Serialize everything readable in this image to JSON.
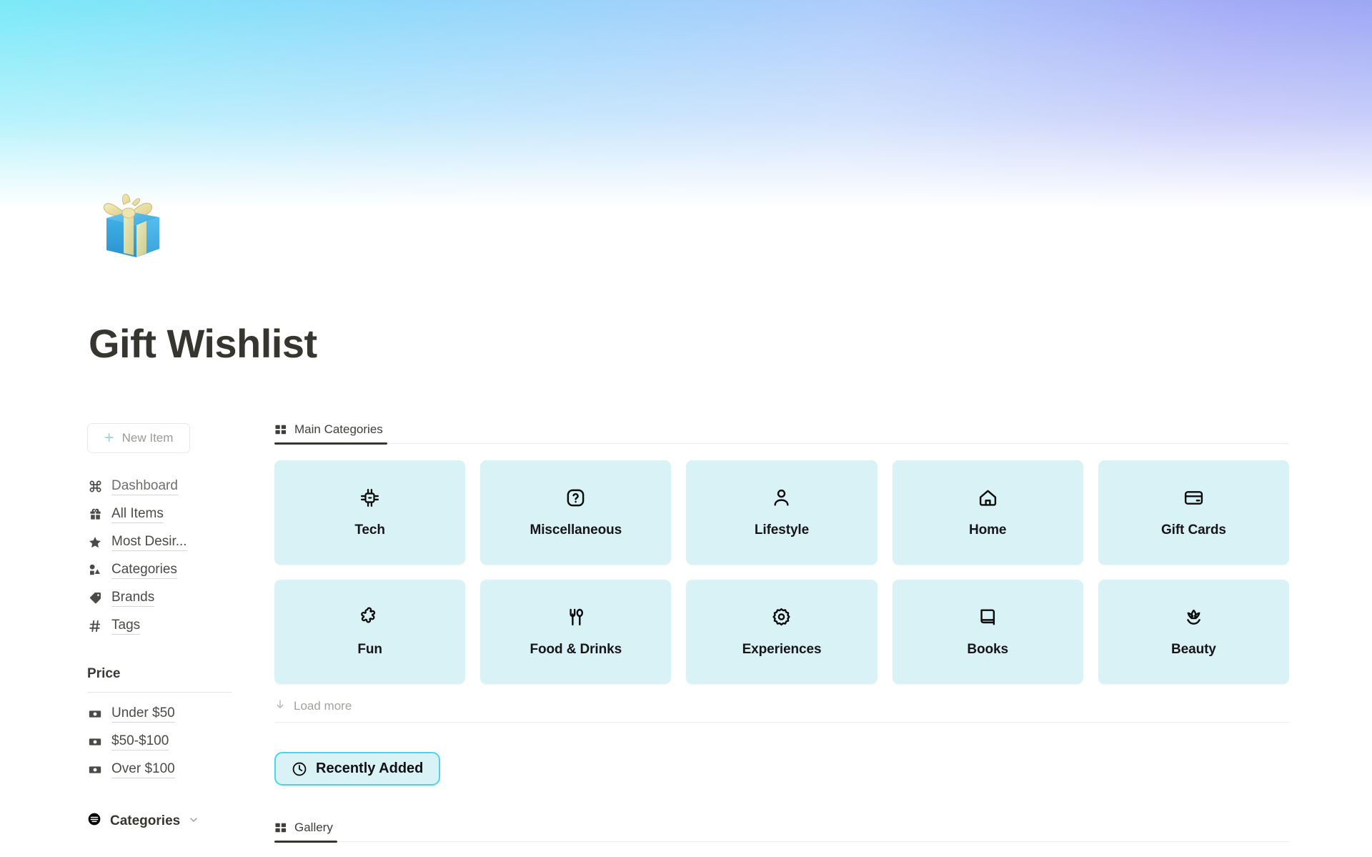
{
  "page": {
    "icon": "gift-box-emoji",
    "title": "Gift Wishlist"
  },
  "theme": {
    "gradient_left": "#7ae9f8",
    "gradient_right": "#9ba6f5",
    "card_bg": "#d8f2f5",
    "accent_border": "#49d6ea",
    "text": "#37352f"
  },
  "sidebar": {
    "new_item_label": "New Item",
    "new_item_icon": "plus-icon",
    "nav": [
      {
        "label": "Dashboard",
        "icon": "command-icon"
      },
      {
        "label": "All Items",
        "icon": "gift-icon"
      },
      {
        "label": "Most Desir...",
        "icon": "star-icon"
      },
      {
        "label": "Categories",
        "icon": "shapes-icon"
      },
      {
        "label": "Brands",
        "icon": "tag-icon"
      },
      {
        "label": "Tags",
        "icon": "hash-icon"
      }
    ],
    "price_section_title": "Price",
    "price": [
      {
        "label": "Under $50",
        "icon": "money-icon"
      },
      {
        "label": "$50-$100",
        "icon": "money-icon"
      },
      {
        "label": "Over $100",
        "icon": "money-icon"
      }
    ],
    "footer": {
      "label": "Categories",
      "icon": "filter-icon",
      "chevron": "chevron-down-icon"
    }
  },
  "main": {
    "tabs": [
      {
        "label": "Main Categories",
        "icon": "grid-icon",
        "active": true
      }
    ],
    "categories": [
      {
        "label": "Tech",
        "icon": "chip-icon"
      },
      {
        "label": "Miscellaneous",
        "icon": "question-icon"
      },
      {
        "label": "Lifestyle",
        "icon": "person-icon"
      },
      {
        "label": "Home",
        "icon": "house-icon"
      },
      {
        "label": "Gift Cards",
        "icon": "credit-card-icon"
      },
      {
        "label": "Fun",
        "icon": "puzzle-icon"
      },
      {
        "label": "Food & Drinks",
        "icon": "fork-spoon-icon"
      },
      {
        "label": "Experiences",
        "icon": "gear-icon"
      },
      {
        "label": "Books",
        "icon": "book-icon"
      },
      {
        "label": "Beauty",
        "icon": "lotus-icon"
      }
    ],
    "load_more": {
      "label": "Load more",
      "icon": "arrow-down-icon"
    },
    "recently_added": {
      "label": "Recently Added",
      "icon": "clock-icon"
    },
    "bottom_tabs": [
      {
        "label": "Gallery",
        "icon": "grid-icon",
        "active": true
      }
    ]
  }
}
